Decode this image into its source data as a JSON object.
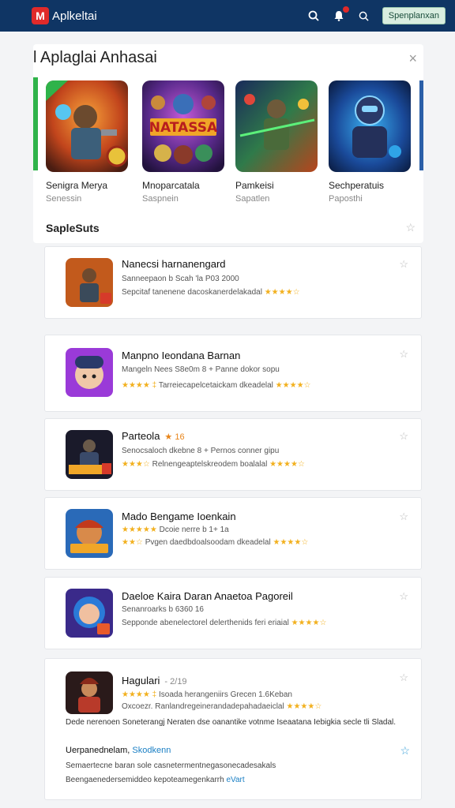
{
  "header": {
    "logo_letter": "M",
    "title": "Aplkeltai",
    "button_label": "Spenplanxan"
  },
  "panel": {
    "title": "l Aplaglai Anhasai",
    "close": "×"
  },
  "featured": [
    {
      "title": "Senigra Merya",
      "subtitle": "Senessin"
    },
    {
      "title": "Mnoparcatala",
      "subtitle": "Saspnein"
    },
    {
      "title": "Pamkeisi",
      "subtitle": "Sapatlen"
    },
    {
      "title": "Sechperatuis",
      "subtitle": "Paposthi"
    }
  ],
  "featured_banner_text": "NATASSA",
  "section": {
    "title": "SapleSuts"
  },
  "apps": [
    {
      "title": "Nanecsi harnanengard",
      "line1": "Sanneepaon b Scah 'la P03 2000",
      "line2_prefix": "",
      "line2": "Sepcitaf tanenene dacoskanerdelakadal",
      "stars_right": "★★★★☆"
    },
    {
      "title": "Manpno Ieondana Barnan",
      "line1": "Mangeln Nees S8e0m 8 + Panne dokor sopu",
      "line2_prefix": "★★★★ ‡",
      "line2": "Tarreiecapelcetaickam dkeadelal",
      "stars_right": "★★★★☆"
    },
    {
      "title": "Parteola",
      "title_rating": "★ 16",
      "line1": "Senocsaloch dkebne 8 + Pernos conner gipu",
      "line2_prefix": "★★★☆",
      "line2": "Relnengeaptelskreodem boalalal",
      "stars_right": "★★★★☆"
    },
    {
      "title": "Mado Bengame Ioenkain",
      "line1_prefix": "★★★★★",
      "line1": "Dcoie nerre b 1+ 1a",
      "line2_prefix": "★★☆",
      "line2": "Pvgen daedbdoalsoodam dkeadelal",
      "stars_right": "★★★★☆"
    },
    {
      "title": "Daeloe Kaira Daran Anaetoa Pagoreil",
      "line1": "Senanroarks b 6360 16",
      "line2_prefix": "",
      "line2": "Sepponde abenelectorel delerthenids feri eriaial",
      "stars_right": "★★★★☆"
    },
    {
      "title": "Hagulari",
      "title_rating": "- 2/19",
      "line1_prefix": "★★★★ ‡",
      "line1": "Isoada herangeniirs Grecen 1.6Keban",
      "line2_prefix": "",
      "line2": "Oxcoezr. Ranlandregeinerandadepahadaeiclal",
      "stars_right": "★★★★☆"
    }
  ],
  "last_card": {
    "desc": "Dede nerenoen Soneterangj Neraten dse oanantike votnme Iseaatana Iebigkia secle tli Sladal.",
    "cta_label": "Uerpanednelam,",
    "cta_link": "Skodkenn",
    "foot1": "Semaertecne baran sole casnetermentnegasonecadesakals",
    "foot2_text": "Beengaenedersemiddeo kepoteamegenkarrh",
    "foot2_link": "eVart"
  },
  "colors": {
    "header_bg": "#0f3564",
    "accent_red": "#e02a2a",
    "star_gold": "#f2b01e",
    "link_blue": "#1a7fc4"
  }
}
